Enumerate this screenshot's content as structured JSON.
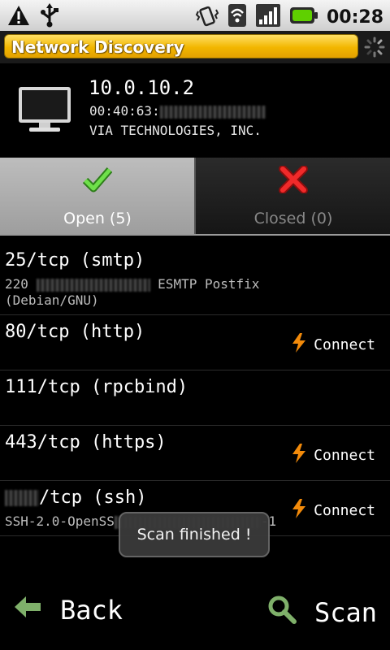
{
  "status_bar": {
    "time": "00:28",
    "icons": [
      "warning-icon",
      "usb-icon",
      "vibrate-icon",
      "wifi-icon",
      "signal-icon",
      "battery-icon"
    ]
  },
  "title_bar": {
    "title": "Network Discovery",
    "colors": {
      "pill": "#f2b600"
    }
  },
  "host": {
    "ip": "10.0.10.2",
    "mac_prefix": "00:40:63:",
    "vendor": "VIA TECHNOLOGIES, INC."
  },
  "tabs": [
    {
      "label": "Open (5)",
      "icon": "check-icon",
      "selected": true,
      "color": "#43b02a"
    },
    {
      "label": "Closed (0)",
      "icon": "cross-icon",
      "selected": false,
      "color": "#e01b1b"
    }
  ],
  "ports": [
    {
      "title": "25/tcp (smtp)",
      "sub_prefix": "220 ",
      "sub_mid": "ESMTP Postfix",
      "sub_line2": "(Debian/GNU)",
      "connect": ""
    },
    {
      "title": "80/tcp (http)",
      "connect": "Connect"
    },
    {
      "title": "111/tcp (rpcbind)",
      "connect": ""
    },
    {
      "title": "443/tcp (https)",
      "connect": "Connect"
    },
    {
      "title": "/tcp (ssh)",
      "sub_prefix": "SSH-2.0-OpenSS",
      "sub_suffix": "-1",
      "connect": "Connect"
    }
  ],
  "toast": "Scan finished !",
  "bottom": {
    "back_label": "Back",
    "scan_label": "Scan"
  }
}
